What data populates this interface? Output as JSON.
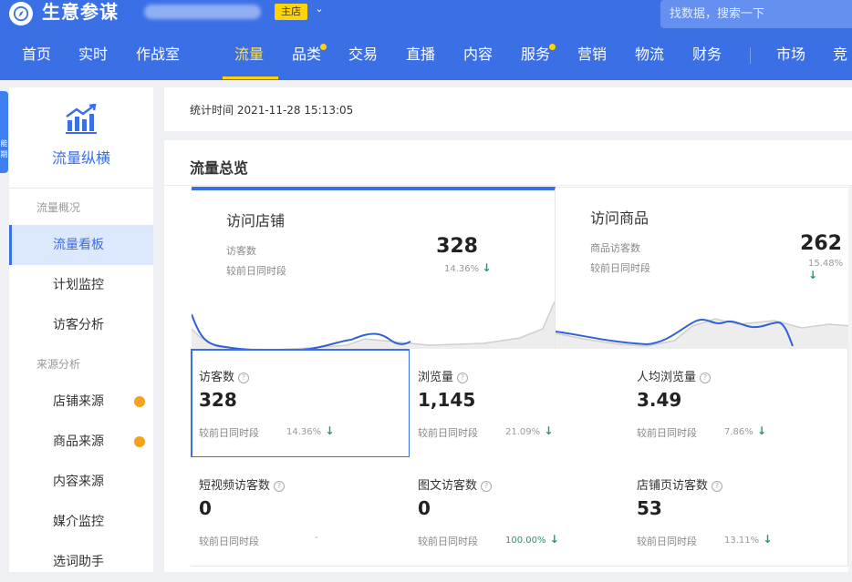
{
  "app": {
    "name": "生意参谋",
    "shop_tag": "主店",
    "chevron_icon": "chevron-down-icon"
  },
  "search": {
    "placeholder": "找数据，搜索一下"
  },
  "nav": {
    "items": [
      {
        "label": "首页"
      },
      {
        "label": "实时"
      },
      {
        "label": "作战室"
      },
      {
        "label": "流量",
        "active": true
      },
      {
        "label": "品类",
        "dot": true
      },
      {
        "label": "交易"
      },
      {
        "label": "直播"
      },
      {
        "label": "内容"
      },
      {
        "label": "服务",
        "dot": true
      },
      {
        "label": "营销"
      },
      {
        "label": "物流"
      },
      {
        "label": "财务"
      },
      {
        "label": "市场"
      },
      {
        "label": "竞"
      }
    ]
  },
  "edge_strip": {
    "text": "能\n期"
  },
  "sidebar": {
    "title": "流量纵横",
    "icon": "bar-chart-trend-icon",
    "sections": [
      {
        "label": "流量概况",
        "items": [
          {
            "label": "流量看板",
            "active": true
          },
          {
            "label": "计划监控"
          },
          {
            "label": "访客分析"
          }
        ]
      },
      {
        "label": "来源分析",
        "items": [
          {
            "label": "店铺来源",
            "dot": true
          },
          {
            "label": "商品来源",
            "dot": true
          },
          {
            "label": "内容来源"
          },
          {
            "label": "媒介监控"
          },
          {
            "label": "选词助手"
          }
        ]
      }
    ]
  },
  "stat_time": "统计时间 2021-11-28 15:13:05",
  "overview": {
    "title": "流量总览",
    "cards": [
      {
        "title": "访问店铺",
        "label": "访客数",
        "compare": "较前日同时段",
        "value": "328",
        "change": "14.36%",
        "trend": "down"
      },
      {
        "title": "访问商品",
        "label": "商品访客数",
        "compare": "较前日同时段",
        "value": "262",
        "change": "15.48%",
        "trend": "down"
      }
    ],
    "metrics": [
      {
        "label": "访客数",
        "value": "328",
        "compare": "较前日同时段",
        "change": "14.36%",
        "trend": "down",
        "selected": true
      },
      {
        "label": "浏览量",
        "value": "1,145",
        "compare": "较前日同时段",
        "change": "21.09%",
        "trend": "down"
      },
      {
        "label": "人均浏览量",
        "value": "3.49",
        "compare": "较前日同时段",
        "change": "7.86%",
        "trend": "down"
      },
      {
        "label": "短视频访客数",
        "value": "0",
        "compare": "较前日同时段",
        "change": "-",
        "trend": "none"
      },
      {
        "label": "图文访客数",
        "value": "0",
        "compare": "较前日同时段",
        "change": "100.00%",
        "trend": "down"
      },
      {
        "label": "店铺页访客数",
        "value": "53",
        "compare": "较前日同时段",
        "change": "13.11%",
        "trend": "down"
      }
    ]
  },
  "colors": {
    "header": "#3b6fe6",
    "accent": "#3b6fe6",
    "active_nav": "#ffe14b",
    "down_arrow": "#19a15f",
    "badge_dot": "#f5a31a"
  }
}
